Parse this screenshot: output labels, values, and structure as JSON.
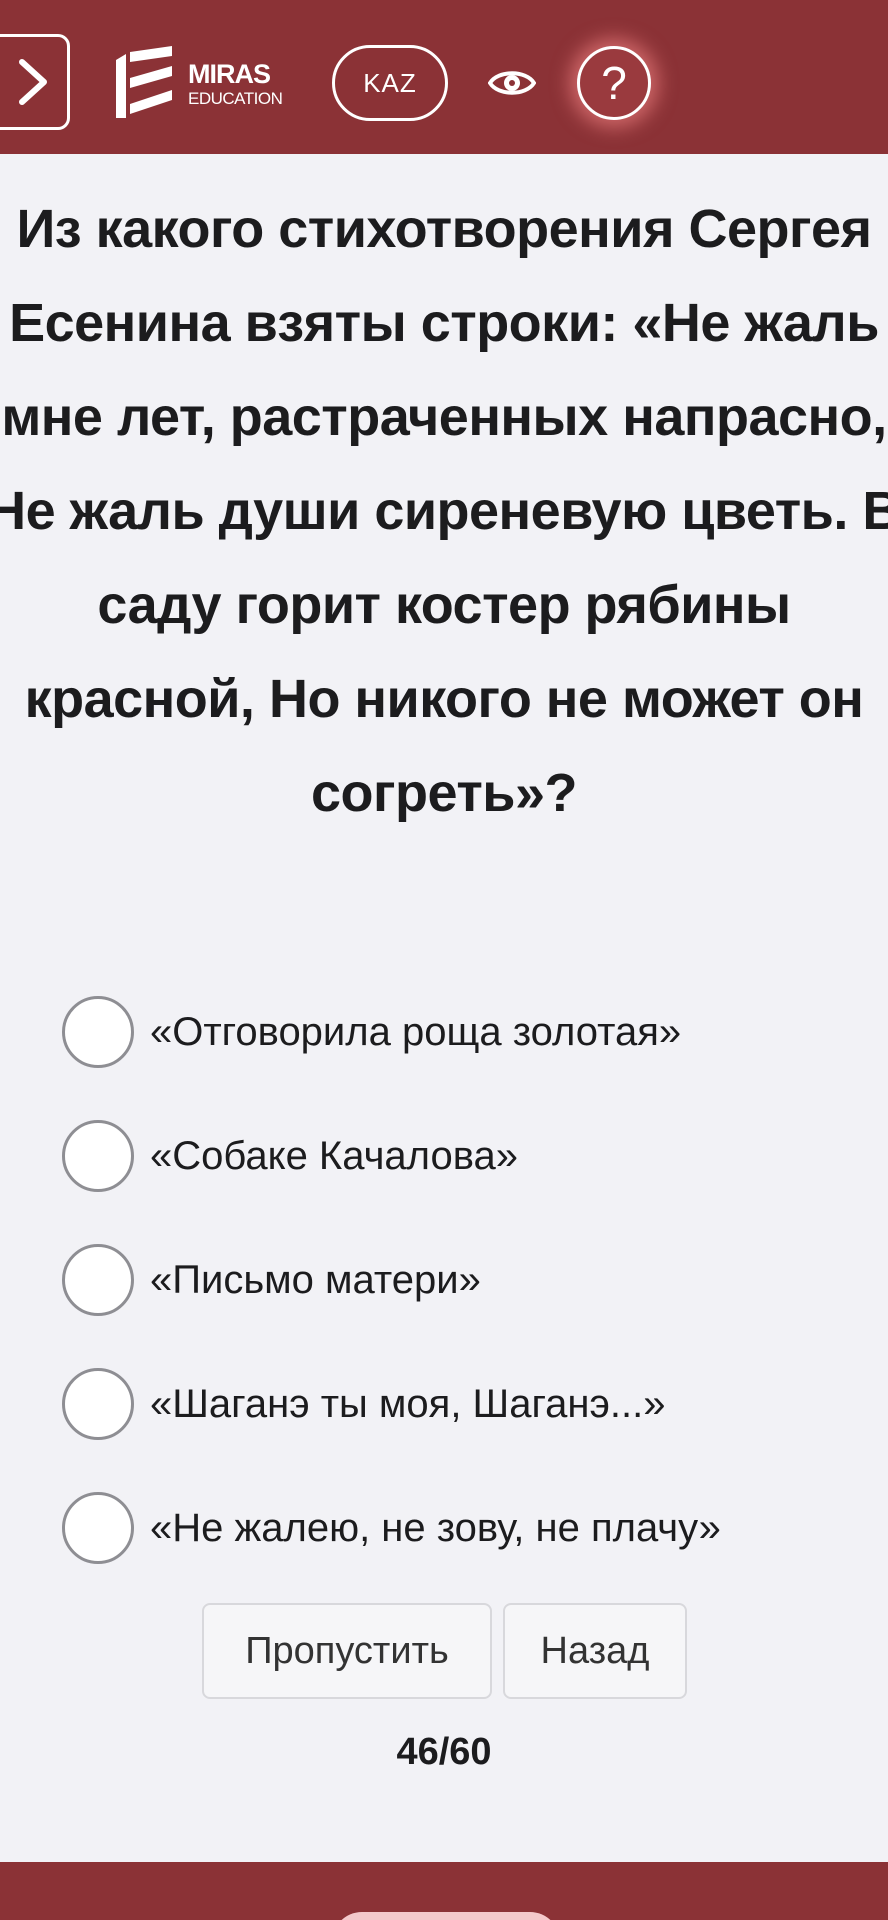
{
  "header": {
    "logo": {
      "name": "MIRAS",
      "subtitle": "EDUCATION"
    },
    "language_label": "KAZ",
    "icons": {
      "nav": "chevron-right-icon",
      "accessibility": "eye-icon",
      "help": "question-mark-icon"
    },
    "help_symbol": "?"
  },
  "question": {
    "text": "Из какого стихотворения Сергея Есенина взяты строки: «Не жаль мне лет, растраченных напрасно, Не жаль души сиреневую цветь. В саду горит костер рябины красной, Но никого не может он согреть»?"
  },
  "options": [
    {
      "label": "«Отговорила роща золотая»",
      "selected": false
    },
    {
      "label": "«Собаке Качалова»",
      "selected": false
    },
    {
      "label": "«Письмо матери»",
      "selected": false
    },
    {
      "label": "«Шаганэ ты моя, Шаганэ...»",
      "selected": false
    },
    {
      "label": "«Не жалею, не зову, не плачу»",
      "selected": false
    }
  ],
  "actions": {
    "skip_label": "Пропустить",
    "back_label": "Назад"
  },
  "progress": {
    "text": "46/60",
    "current": 46,
    "total": 60
  },
  "colors": {
    "brand": "#8b3236",
    "background": "#f2f2f6"
  }
}
